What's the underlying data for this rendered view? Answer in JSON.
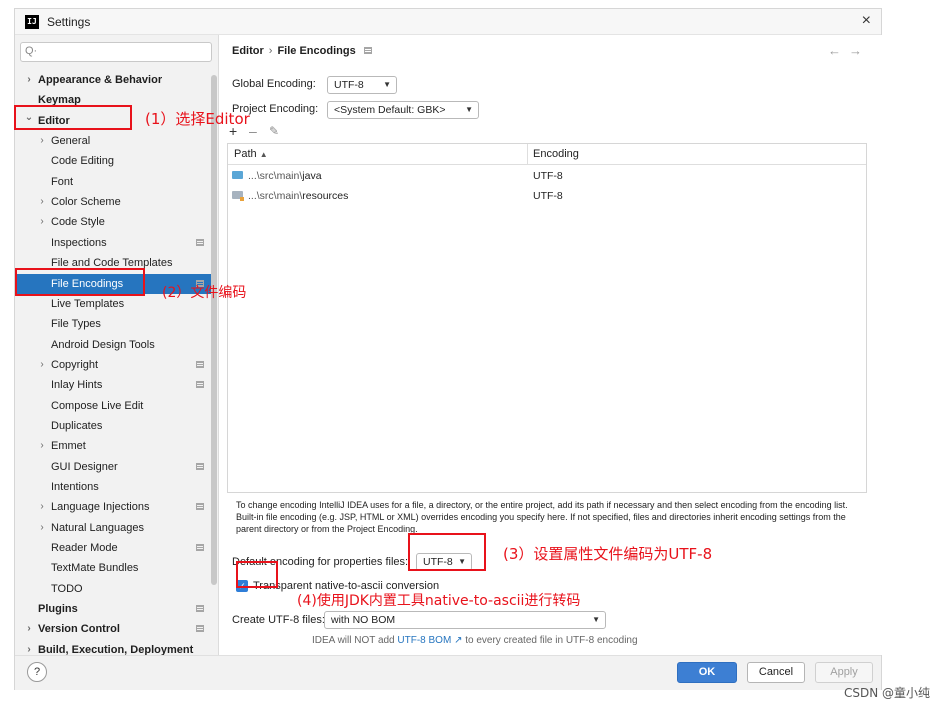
{
  "window": {
    "title": "Settings",
    "close_glyph": "×",
    "app_icon_label": "IJ"
  },
  "search": {
    "icon": "search-icon",
    "glyph": "Q·"
  },
  "sidebar": {
    "items": [
      {
        "label": "Appearance & Behavior",
        "level": 0,
        "chevron": ">",
        "bold": true
      },
      {
        "label": "Keymap",
        "level": 0,
        "chevron": "",
        "bold": true
      },
      {
        "label": "Editor",
        "level": 0,
        "chevron": "v",
        "bold": true
      },
      {
        "label": "General",
        "level": 1,
        "chevron": ">"
      },
      {
        "label": "Code Editing",
        "level": 1,
        "chevron": ""
      },
      {
        "label": "Font",
        "level": 1,
        "chevron": ""
      },
      {
        "label": "Color Scheme",
        "level": 1,
        "chevron": ">"
      },
      {
        "label": "Code Style",
        "level": 1,
        "chevron": ">"
      },
      {
        "label": "Inspections",
        "level": 1,
        "chevron": "",
        "icon": true
      },
      {
        "label": "File and Code Templates",
        "level": 1,
        "chevron": ""
      },
      {
        "label": "File Encodings",
        "level": 1,
        "chevron": "",
        "icon": true,
        "selected": true
      },
      {
        "label": "Live Templates",
        "level": 1,
        "chevron": ""
      },
      {
        "label": "File Types",
        "level": 1,
        "chevron": ""
      },
      {
        "label": "Android Design Tools",
        "level": 1,
        "chevron": ""
      },
      {
        "label": "Copyright",
        "level": 1,
        "chevron": ">",
        "icon": true
      },
      {
        "label": "Inlay Hints",
        "level": 1,
        "chevron": "",
        "icon": true
      },
      {
        "label": "Compose Live Edit",
        "level": 1,
        "chevron": ""
      },
      {
        "label": "Duplicates",
        "level": 1,
        "chevron": ""
      },
      {
        "label": "Emmet",
        "level": 1,
        "chevron": ">"
      },
      {
        "label": "GUI Designer",
        "level": 1,
        "chevron": "",
        "icon": true
      },
      {
        "label": "Intentions",
        "level": 1,
        "chevron": ""
      },
      {
        "label": "Language Injections",
        "level": 1,
        "chevron": ">",
        "icon": true
      },
      {
        "label": "Natural Languages",
        "level": 1,
        "chevron": ">"
      },
      {
        "label": "Reader Mode",
        "level": 1,
        "chevron": "",
        "icon": true
      },
      {
        "label": "TextMate Bundles",
        "level": 1,
        "chevron": ""
      },
      {
        "label": "TODO",
        "level": 1,
        "chevron": ""
      },
      {
        "label": "Plugins",
        "level": 0,
        "chevron": "",
        "bold": true,
        "icon": true
      },
      {
        "label": "Version Control",
        "level": 0,
        "chevron": ">",
        "bold": true,
        "icon": true
      },
      {
        "label": "Build, Execution, Deployment",
        "level": 0,
        "chevron": ">",
        "bold": true
      }
    ]
  },
  "breadcrumb": {
    "parent": "Editor",
    "separator": "›",
    "current": "File Encodings"
  },
  "nav": {
    "back": "←",
    "forward": "→"
  },
  "global_encoding": {
    "label": "Global Encoding:",
    "value": "UTF-8"
  },
  "project_encoding": {
    "label": "Project Encoding:",
    "value": "<System Default: GBK>"
  },
  "toolbar": {
    "add": "+",
    "remove": "–",
    "edit": "✎"
  },
  "table": {
    "columns": {
      "path": "Path",
      "sort_glyph": "▲",
      "encoding": "Encoding"
    },
    "rows": [
      {
        "prefix": "...\\src\\main\\",
        "name": "java",
        "encoding": "UTF-8",
        "icon": "source-folder-icon"
      },
      {
        "prefix": "...\\src\\main\\",
        "name": "resources",
        "encoding": "UTF-8",
        "icon": "resources-folder-icon"
      }
    ]
  },
  "description": "To change encoding IntelliJ IDEA uses for a file, a directory, or the entire project, add its path if necessary and then select encoding from the encoding list. Built-in file encoding (e.g. JSP, HTML or XML) overrides encoding you specify here. If not specified, files and directories inherit encoding settings from the parent directory or from the Project Encoding.",
  "properties_encoding": {
    "label": "Default encoding for properties files:",
    "value": "UTF-8"
  },
  "native_to_ascii": {
    "label": "Transparent native-to-ascii conversion",
    "checked": true,
    "check_glyph": "✓"
  },
  "create_utf8": {
    "label": "Create UTF-8 files:",
    "value": "with NO BOM"
  },
  "hint": {
    "before": "IDEA will NOT add ",
    "link": "UTF-8 BOM ↗",
    "after": " to every created file in UTF-8 encoding"
  },
  "buttons": {
    "help": "?",
    "ok": "OK",
    "cancel": "Cancel",
    "apply": "Apply"
  },
  "annotations": {
    "a1": "(1）选择Editor",
    "a2": "(2）文件编码",
    "a3": "(3）设置属性文件编码为UTF-8",
    "a4": "(4)使用JDK内置工具native-to-ascii进行转码"
  },
  "watermark": "CSDN @童小纯",
  "colors": {
    "accent": "#2675bf",
    "annotation": "#e8121b",
    "ok_button": "#3d7fd3"
  }
}
